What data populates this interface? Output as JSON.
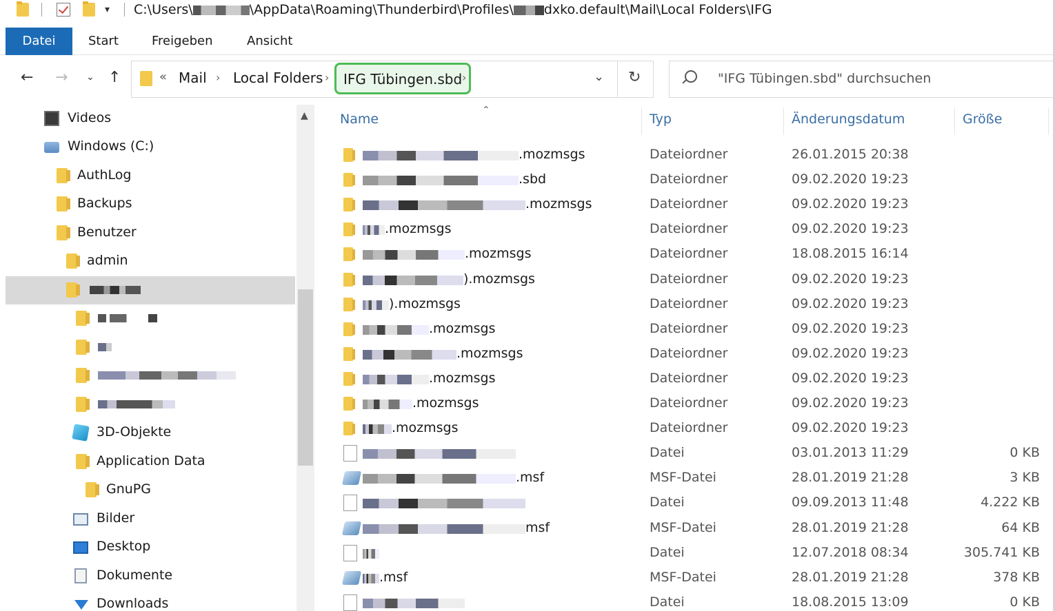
{
  "titlebar": {
    "path_prefix": "C:\\Users\\",
    "path_mid": "\\AppData\\Roaming\\Thunderbird\\Profiles\\",
    "path_suffix": "dxko.default\\Mail\\Local Folders\\IFG"
  },
  "ribbon": {
    "tabs": [
      "Datei",
      "Start",
      "Freigeben",
      "Ansicht"
    ]
  },
  "address": {
    "overflow": "«",
    "crumbs": [
      "Mail",
      "Local Folders"
    ],
    "current": "IFG Tübingen.sbd"
  },
  "search": {
    "placeholder": "\"IFG Tübingen.sbd\" durchsuchen"
  },
  "nav": {
    "items": [
      {
        "label": "Videos",
        "icon": "video-icon"
      },
      {
        "label": "Windows (C:)",
        "icon": "drive-icon"
      },
      {
        "label": "AuthLog",
        "icon": "folder-icon"
      },
      {
        "label": "Backups",
        "icon": "folder-icon"
      },
      {
        "label": "Benutzer",
        "icon": "folder-icon"
      },
      {
        "label": "admin",
        "icon": "folder-icon"
      },
      {
        "label": "",
        "icon": "folder-icon"
      },
      {
        "label": "",
        "icon": "folder-icon"
      },
      {
        "label": "",
        "icon": "folder-icon"
      },
      {
        "label": "",
        "icon": "folder-icon"
      },
      {
        "label": "",
        "icon": "folder-icon"
      },
      {
        "label": "3D-Objekte",
        "icon": "3d-objects-icon"
      },
      {
        "label": "Application Data",
        "icon": "folder-icon"
      },
      {
        "label": "GnuPG",
        "icon": "folder-icon"
      },
      {
        "label": "Bilder",
        "icon": "pictures-icon"
      },
      {
        "label": "Desktop",
        "icon": "desktop-icon"
      },
      {
        "label": "Dokumente",
        "icon": "documents-icon"
      },
      {
        "label": "Downloads",
        "icon": "downloads-icon"
      }
    ]
  },
  "columns": {
    "name": "Name",
    "type": "Typ",
    "date": "Änderungsdatum",
    "size": "Größe"
  },
  "files": [
    {
      "name": ".mozmsgs",
      "type": "Dateiordner",
      "date": "26.01.2015 20:38",
      "size": "",
      "kind": "folder"
    },
    {
      "name": ".sbd",
      "type": "Dateiordner",
      "date": "09.02.2020 19:23",
      "size": "",
      "kind": "folder"
    },
    {
      "name": ".mozmsgs",
      "type": "Dateiordner",
      "date": "09.02.2020 19:23",
      "size": "",
      "kind": "folder"
    },
    {
      "name": ".mozmsgs",
      "type": "Dateiordner",
      "date": "09.02.2020 19:23",
      "size": "",
      "kind": "folder"
    },
    {
      "name": ".mozmsgs",
      "type": "Dateiordner",
      "date": "18.08.2015 16:14",
      "size": "",
      "kind": "folder"
    },
    {
      "name": ").mozmsgs",
      "type": "Dateiordner",
      "date": "09.02.2020 19:23",
      "size": "",
      "kind": "folder"
    },
    {
      "name": ").mozmsgs",
      "type": "Dateiordner",
      "date": "09.02.2020 19:23",
      "size": "",
      "kind": "folder"
    },
    {
      "name": ".mozmsgs",
      "type": "Dateiordner",
      "date": "09.02.2020 19:23",
      "size": "",
      "kind": "folder"
    },
    {
      "name": ".mozmsgs",
      "type": "Dateiordner",
      "date": "09.02.2020 19:23",
      "size": "",
      "kind": "folder"
    },
    {
      "name": ".mozmsgs",
      "type": "Dateiordner",
      "date": "09.02.2020 19:23",
      "size": "",
      "kind": "folder"
    },
    {
      "name": ".mozmsgs",
      "type": "Dateiordner",
      "date": "09.02.2020 19:23",
      "size": "",
      "kind": "folder"
    },
    {
      "name": ".mozmsgs",
      "type": "Dateiordner",
      "date": "09.02.2020 19:23",
      "size": "",
      "kind": "folder"
    },
    {
      "name": "",
      "type": "Datei",
      "date": "03.01.2013 11:29",
      "size": "0 KB",
      "kind": "file"
    },
    {
      "name": ".msf",
      "type": "MSF-Datei",
      "date": "28.01.2019 21:28",
      "size": "3 KB",
      "kind": "msf"
    },
    {
      "name": "",
      "type": "Datei",
      "date": "09.09.2013 11:48",
      "size": "4.222 KB",
      "kind": "file"
    },
    {
      "name": "msf",
      "type": "MSF-Datei",
      "date": "28.01.2019 21:28",
      "size": "64 KB",
      "kind": "msf"
    },
    {
      "name": "",
      "type": "Datei",
      "date": "12.07.2018 08:34",
      "size": "305.741 KB",
      "kind": "file"
    },
    {
      "name": ".msf",
      "type": "MSF-Datei",
      "date": "28.01.2019 21:28",
      "size": "378 KB",
      "kind": "msf"
    },
    {
      "name": "",
      "type": "Datei",
      "date": "18.08.2015 13:09",
      "size": "0 KB",
      "kind": "file"
    }
  ],
  "colors": {
    "accent": "#1c6bb6",
    "highlight_border": "#4cbb55",
    "header_text": "#3a6ea5",
    "selected_row": "#d9d9d9"
  }
}
